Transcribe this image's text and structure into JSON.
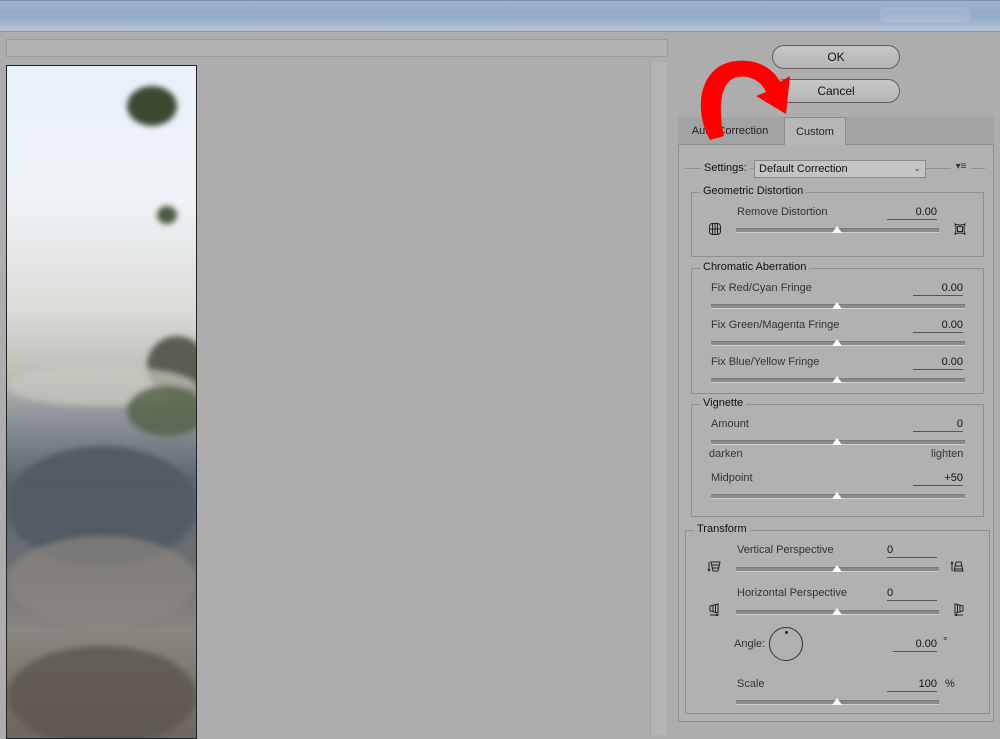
{
  "buttons": {
    "ok": "OK",
    "cancel": "Cancel"
  },
  "tabs": [
    {
      "label": "Auto Correction",
      "active": false
    },
    {
      "label": "Custom",
      "active": true
    }
  ],
  "settings": {
    "label": "Settings:",
    "value": "Default Correction"
  },
  "geometric": {
    "title": "Geometric Distortion",
    "remove_distortion": {
      "label": "Remove Distortion",
      "value": "0.00"
    }
  },
  "chromatic": {
    "title": "Chromatic Aberration",
    "red_cyan": {
      "label": "Fix Red/Cyan Fringe",
      "value": "0.00"
    },
    "green_magenta": {
      "label": "Fix Green/Magenta Fringe",
      "value": "0.00"
    },
    "blue_yellow": {
      "label": "Fix Blue/Yellow Fringe",
      "value": "0.00"
    }
  },
  "vignette": {
    "title": "Vignette",
    "amount": {
      "label": "Amount",
      "value": "0",
      "left": "darken",
      "right": "lighten"
    },
    "midpoint": {
      "label": "Midpoint",
      "value": "+50"
    }
  },
  "transform": {
    "title": "Transform",
    "vertical": {
      "label": "Vertical Perspective",
      "value": "0"
    },
    "horizontal": {
      "label": "Horizontal Perspective",
      "value": "0"
    },
    "angle": {
      "label": "Angle:",
      "value": "0.00",
      "unit": "°"
    },
    "scale": {
      "label": "Scale",
      "value": "100",
      "unit": "%"
    }
  },
  "colors": {
    "annotation_arrow": "#ff0000",
    "panel_bg": "#b1b1b1",
    "titlebar": "#9fb3cf"
  }
}
